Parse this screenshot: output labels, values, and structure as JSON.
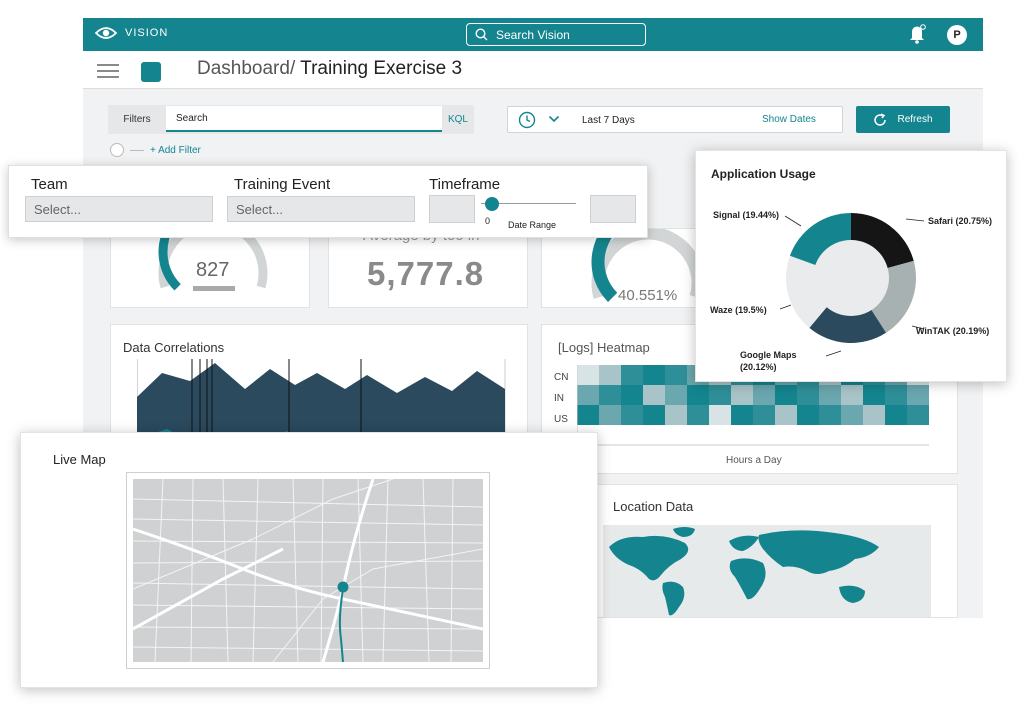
{
  "app": {
    "brand": "VISION",
    "search_placeholder": "Search Vision",
    "avatar_initial": "P",
    "breadcrumb_home": "Dashboard/",
    "breadcrumb_page": " Training Exercise 3"
  },
  "toolbar": {
    "filters_label": "Filters",
    "search_value": "Search",
    "kql_label": "KQL",
    "date_range_value": "Last 7 Days",
    "show_dates_label": "Show Dates",
    "refresh_label": "Refresh",
    "add_filter_label": "+ Add Filter"
  },
  "filter_panel": {
    "team_label": "Team",
    "team_placeholder": "Select...",
    "event_label": "Training Event",
    "event_placeholder": "Select...",
    "timeframe_label": "Timeframe",
    "slider_min": "0",
    "slider_caption": "Date Range"
  },
  "kpis": {
    "kpi1_value": "827",
    "kpi1_gauge_fraction": 0.62,
    "kpi2_cut_label": "Average by too in",
    "kpi2_value": "5,777.8",
    "kpi3_value": "40.551%",
    "kpi3_gauge_fraction": 0.41
  },
  "data_correlations": {
    "title": "Data Correlations"
  },
  "heatmap": {
    "title": "[Logs] Heatmap",
    "rows": [
      "CN",
      "IN",
      "US"
    ],
    "xlabel": "Hours a Day"
  },
  "location": {
    "title": "Location Data"
  },
  "live_map": {
    "title": "Live Map"
  },
  "colors": {
    "accent": "#14858f",
    "dark": "#2b4a5e",
    "black": "#151515",
    "gray": "#a7b1b1",
    "light": "#e9ebec"
  },
  "app_usage": {
    "title": "Application Usage",
    "labels": {
      "signal": "Signal (19.44%)",
      "safari": "Safari (20.75%)",
      "waze": "Waze (19.5%)",
      "google_maps_1": "Google Maps",
      "google_maps_2": "(20.12%)",
      "wintak": "WinTAK (20.19%)"
    }
  },
  "chart_data": {
    "type": "pie",
    "title": "Application Usage",
    "categories": [
      "Safari",
      "WinTAK",
      "Google Maps",
      "Waze",
      "Signal"
    ],
    "values": [
      20.75,
      20.19,
      20.12,
      19.5,
      19.44
    ],
    "colors": [
      "#151515",
      "#a7b1b1",
      "#2b4a5e",
      "#e9ebec",
      "#14858f"
    ]
  }
}
